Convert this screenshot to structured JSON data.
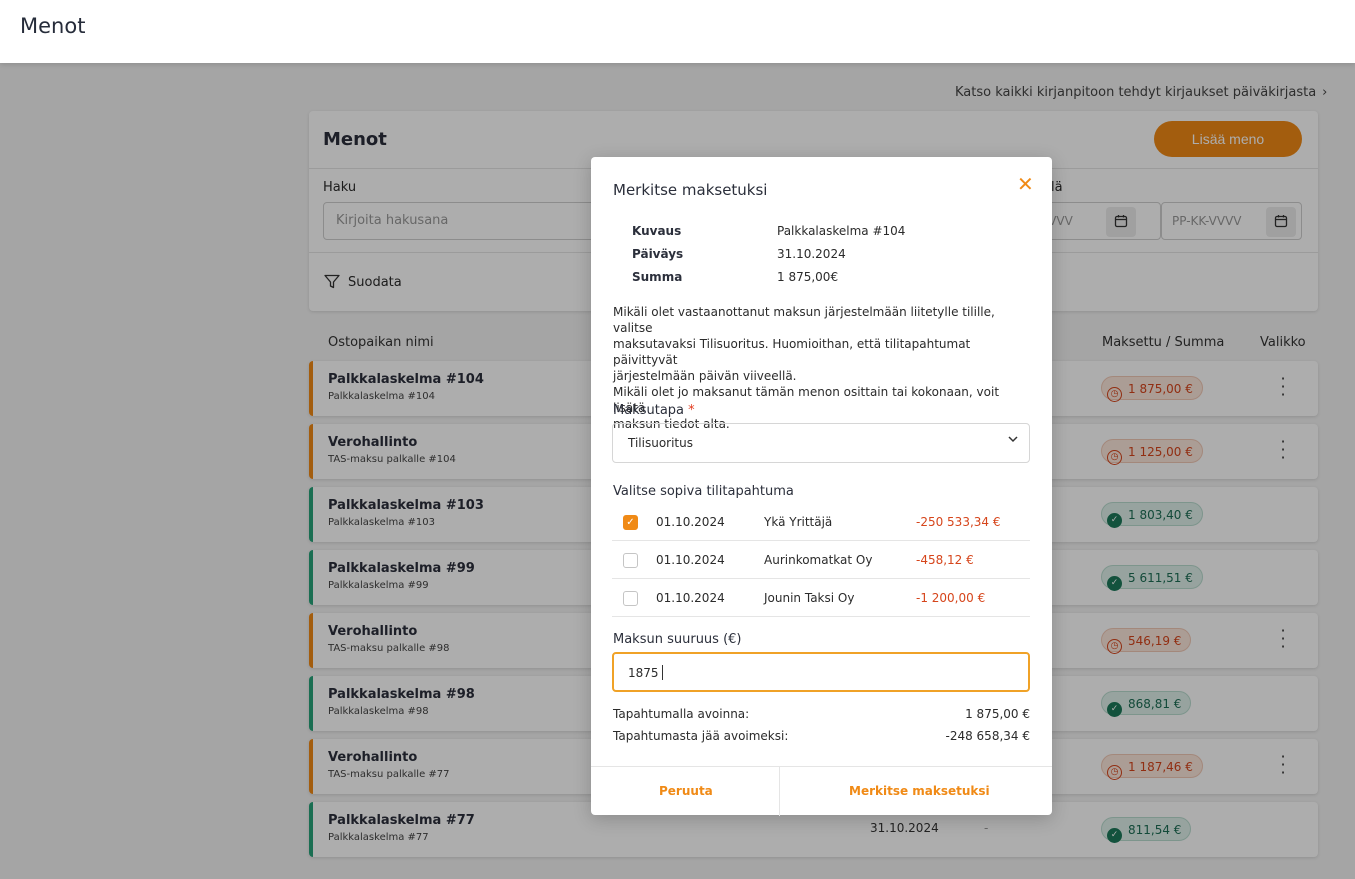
{
  "topbar": {
    "title": "Menot"
  },
  "diary_link": {
    "label": "Katso kaikki kirjanpitoon tehdyt kirjaukset päiväkirjasta",
    "icon": "chevron-right-icon"
  },
  "card": {
    "title": "Menot",
    "add_button": "Lisää meno",
    "search_label": "Haku",
    "search_placeholder": "Kirjoita hakusana",
    "to_label_partial": "lä",
    "date_from_placeholder_partial": "VVVV",
    "date_to_placeholder": "PP-KK-VVVV",
    "filter_label": "Suodata"
  },
  "columns": {
    "name": "Ostopaikan nimi",
    "paid_total": "Maksettu / Summa",
    "menu": "Valikko"
  },
  "rows": [
    {
      "name": "Palkkalaskelma #104",
      "sub": "Palkkalaskelma #104",
      "status": "unpaid",
      "amount": "1 875,00 €",
      "menu": true,
      "date": "",
      "dash": ""
    },
    {
      "name": "Verohallinto",
      "sub": "TAS-maksu palkalle #104",
      "status": "unpaid",
      "amount": "1 125,00 €",
      "menu": true,
      "date": "",
      "dash": ""
    },
    {
      "name": "Palkkalaskelma #103",
      "sub": "Palkkalaskelma #103",
      "status": "paid",
      "amount": "1 803,40 €",
      "menu": false,
      "date": "",
      "dash": ""
    },
    {
      "name": "Palkkalaskelma #99",
      "sub": "Palkkalaskelma #99",
      "status": "paid",
      "amount": "5 611,51 €",
      "menu": false,
      "date": "",
      "dash": ""
    },
    {
      "name": "Verohallinto",
      "sub": "TAS-maksu palkalle #98",
      "status": "unpaid",
      "amount": "546,19 €",
      "menu": true,
      "date": "",
      "dash": ""
    },
    {
      "name": "Palkkalaskelma #98",
      "sub": "Palkkalaskelma #98",
      "status": "paid",
      "amount": "868,81 €",
      "menu": false,
      "date": "",
      "dash": ""
    },
    {
      "name": "Verohallinto",
      "sub": "TAS-maksu palkalle #77",
      "status": "unpaid",
      "amount": "1 187,46 €",
      "menu": true,
      "date": "",
      "dash": ""
    },
    {
      "name": "Palkkalaskelma #77",
      "sub": "Palkkalaskelma #77",
      "status": "paid",
      "amount": "811,54 €",
      "menu": false,
      "date": "31.10.2024",
      "dash": "-"
    }
  ],
  "colors": {
    "accent": "#f08a16",
    "unpaid_stripe": "#f08a16",
    "paid_stripe": "#27a37a",
    "negative": "#d6451b"
  },
  "modal": {
    "title": "Merkitse maksetuksi",
    "close_icon": "close-icon",
    "info": [
      {
        "label": "Kuvaus",
        "value": "Palkkalaskelma #104"
      },
      {
        "label": "Päiväys",
        "value": "31.10.2024"
      },
      {
        "label": "Summa",
        "value": "1 875,00€"
      }
    ],
    "description": [
      "Mikäli olet vastaanottanut maksun järjestelmään liitetylle tilille, valitse",
      "maksutavaksi Tilisuoritus. Huomioithan, että tilitapahtumat päivittyvät",
      "järjestelmään päivän viiveellä.",
      "Mikäli olet jo maksanut tämän menon osittain tai kokonaan, voit lisätä",
      "maksun tiedot alta."
    ],
    "payment_method_label": "Maksutapa",
    "required_mark": "*",
    "payment_method_value": "Tilisuoritus",
    "transactions_label": "Valitse sopiva tilitapahtuma",
    "transactions": [
      {
        "checked": true,
        "date": "01.10.2024",
        "name": "Ykä Yrittäjä",
        "amount": "-250 533,34 €"
      },
      {
        "checked": false,
        "date": "01.10.2024",
        "name": "Aurinkomatkat Oy",
        "amount": "-458,12 €"
      },
      {
        "checked": false,
        "date": "01.10.2024",
        "name": "Jounin Taksi Oy",
        "amount": "-1 200,00 €"
      }
    ],
    "amount_label": "Maksun suuruus (€)",
    "amount_value": "1875",
    "open_on_tx_label": "Tapahtumalla avoinna:",
    "open_on_tx_value": "1 875,00 €",
    "remaining_label": "Tapahtumasta jää avoimeksi:",
    "remaining_value": "-248 658,34 €",
    "cancel_button": "Peruuta",
    "confirm_button": "Merkitse maksetuksi"
  }
}
